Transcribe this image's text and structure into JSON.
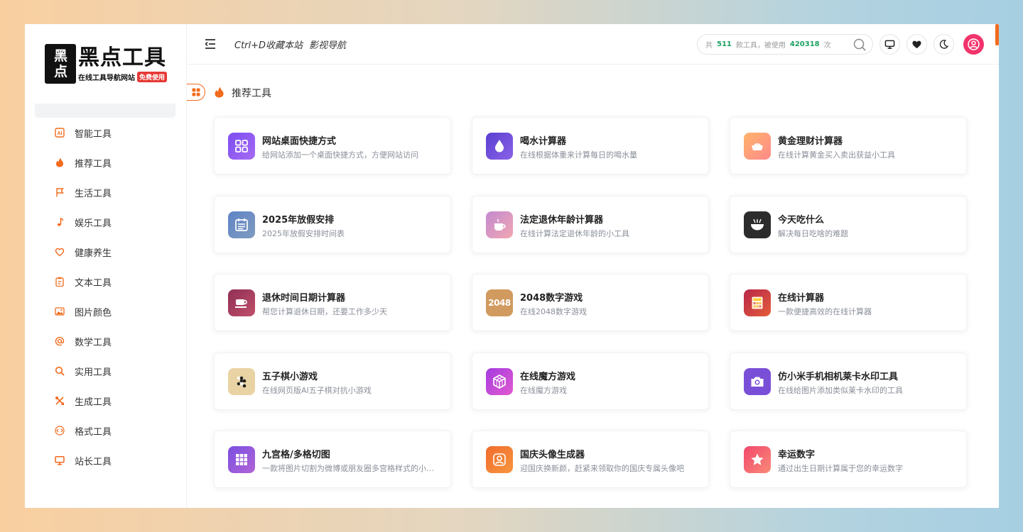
{
  "logo": {
    "mark_top": "黑",
    "mark_bottom": "点",
    "title": "黑点工具",
    "subtitle": "在线工具导航网站",
    "badge": "免费使用"
  },
  "sidebar": {
    "items": [
      {
        "label": "智能工具",
        "icon": "ai-icon"
      },
      {
        "label": "推荐工具",
        "icon": "flame-icon"
      },
      {
        "label": "生活工具",
        "icon": "flag-icon"
      },
      {
        "label": "娱乐工具",
        "icon": "music-note-icon"
      },
      {
        "label": "健康养生",
        "icon": "heart-icon"
      },
      {
        "label": "文本工具",
        "icon": "clipboard-icon"
      },
      {
        "label": "图片颜色",
        "icon": "image-icon"
      },
      {
        "label": "数学工具",
        "icon": "at-sign-icon"
      },
      {
        "label": "实用工具",
        "icon": "search-icon"
      },
      {
        "label": "生成工具",
        "icon": "tools-icon"
      },
      {
        "label": "格式工具",
        "icon": "code-icon"
      },
      {
        "label": "站长工具",
        "icon": "monitor-icon"
      }
    ]
  },
  "header": {
    "link1": "Ctrl+D收藏本站",
    "link2": "影视导航",
    "search": {
      "prefix": "共",
      "tool_count": "511",
      "middle": "款工具，被使用",
      "use_count": "420318",
      "suffix": "次"
    }
  },
  "section": {
    "title": "推荐工具"
  },
  "cards": [
    {
      "title": "网站桌面快捷方式",
      "desc": "给网站添加一个桌面快捷方式，方便网站访问",
      "icon": "grid-apps-icon",
      "color": "#8b5cf6"
    },
    {
      "title": "喝水计算器",
      "desc": "在线根据体重来计算每日的喝水量",
      "icon": "water-drop-icon",
      "color": "#6d4fd8"
    },
    {
      "title": "黄金理财计算器",
      "desc": "在线计算黄金买入卖出获益小工具",
      "icon": "gold-ingot-icon",
      "color": "#f59a6a"
    },
    {
      "title": "2025年放假安排",
      "desc": "2025年放假安排时间表",
      "icon": "calendar-icon",
      "color": "#6b8bbd"
    },
    {
      "title": "法定退休年龄计算器",
      "desc": "在线计算法定退休年龄的小工具",
      "icon": "coffee-cup-icon",
      "color": "#d89ab8"
    },
    {
      "title": "今天吃什么",
      "desc": "解决每日吃啥的难题",
      "icon": "bowl-icon",
      "color": "#2c2c2c"
    },
    {
      "title": "退休时间日期计算器",
      "desc": "帮您计算退休日期，还要工作多少天",
      "icon": "tea-cup-icon",
      "color": "#a43d5a"
    },
    {
      "title": "2048数字游戏",
      "desc": "在线2048数字游戏",
      "icon": "2048-icon",
      "icon_text": "2048",
      "color": "#d19a5e"
    },
    {
      "title": "在线计算器",
      "desc": "一款便捷高效的在线计算器",
      "icon": "calculator-icon",
      "color": "#c8304d"
    },
    {
      "title": "五子棋小游戏",
      "desc": "在线网页版AI五子棋对抗小游戏",
      "icon": "gomoku-icon",
      "color": "#e9d3a4"
    },
    {
      "title": "在线魔方游戏",
      "desc": "在线魔方游戏",
      "icon": "cube-icon",
      "color": "#c442d8"
    },
    {
      "title": "仿小米手机相机莱卡水印工具",
      "desc": "在线给图片添加类似莱卡水印的工具",
      "icon": "camera-icon",
      "color": "#7a4fd8"
    },
    {
      "title": "九宫格/多格切图",
      "desc": "一款将图片切割为微博或朋友圈多宫格样式的小工具",
      "icon": "nine-grid-icon",
      "color": "#8d56d6"
    },
    {
      "title": "国庆头像生成器",
      "desc": "迎国庆换新颜，赶紧来领取你的国庆专属头像吧",
      "icon": "user-avatar-icon",
      "color": "#f2743a"
    },
    {
      "title": "幸运数字",
      "desc": "通过出生日期计算属于您的幸运数字",
      "icon": "star-icon",
      "color": "#f2576b"
    }
  ],
  "colors": {
    "accent": "#f26b1d",
    "count_green": "#1aa260",
    "avatar": "#f2336c"
  }
}
